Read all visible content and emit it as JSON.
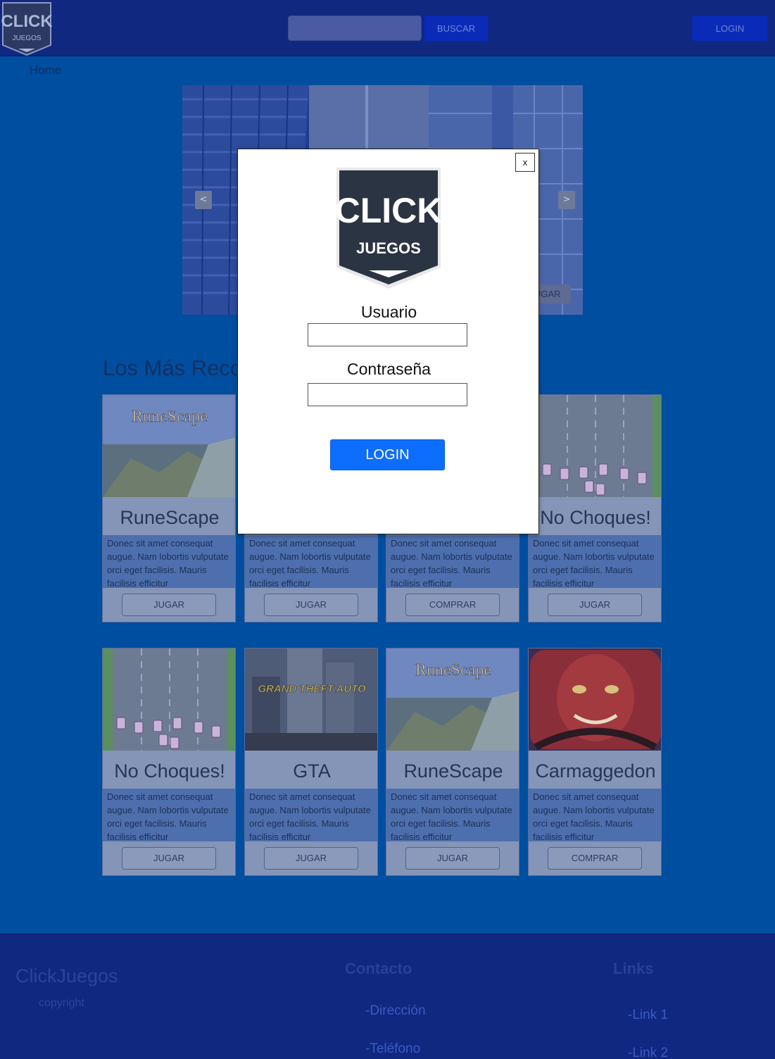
{
  "header": {
    "logo_text_top": "CLICK",
    "logo_text_bottom": "JUEGOS",
    "search_placeholder": "",
    "search_button": "BUSCAR",
    "login_button": "LOGIN"
  },
  "nav": {
    "home": "Home"
  },
  "carousel": {
    "prev": "<",
    "next": ">",
    "cta": "JUGAR"
  },
  "section_title": "Los Más Recomendados",
  "cards_row1": [
    {
      "title": "RuneScape",
      "desc": "Donec sit amet consequat augue. Nam lobortis vulputate orci eget facilisis. Mauris facilisis efficitur",
      "button": "JUGAR"
    },
    {
      "title": "",
      "desc": "Donec sit amet consequat augue. Nam lobortis vulputate orci eget facilisis. Mauris facilisis efficitur",
      "button": "JUGAR"
    },
    {
      "title": "",
      "desc": "Donec sit amet consequat augue. Nam lobortis vulputate orci eget facilisis. Mauris facilisis efficitur",
      "button": "COMPRAR"
    },
    {
      "title": "No Choques!",
      "desc": "Donec sit amet consequat augue. Nam lobortis vulputate orci eget facilisis. Mauris facilisis efficitur",
      "button": "JUGAR"
    }
  ],
  "cards_row2": [
    {
      "title": "No Choques!",
      "desc": "Donec sit amet consequat augue. Nam lobortis vulputate orci eget facilisis. Mauris facilisis efficitur",
      "button": "JUGAR"
    },
    {
      "title": "GTA",
      "desc": "Donec sit amet consequat augue. Nam lobortis vulputate orci eget facilisis. Mauris facilisis efficitur",
      "button": "JUGAR"
    },
    {
      "title": "RuneScape",
      "desc": "Donec sit amet consequat augue. Nam lobortis vulputate orci eget facilisis. Mauris facilisis efficitur",
      "button": "JUGAR"
    },
    {
      "title": "Carmaggedon",
      "desc": "Donec sit amet consequat augue. Nam lobortis vulputate orci eget facilisis. Mauris facilisis efficitur",
      "button": "COMPRAR"
    }
  ],
  "card_art": {
    "runescape_logo": "RuneScape",
    "gta_logo": "GRAND THEFT AUTO"
  },
  "footer": {
    "brand": "ClickJuegos",
    "copyright": "copyright",
    "contact_heading": "Contacto",
    "contact_items": [
      "-Dirección",
      "-Teléfono"
    ],
    "links_heading": "Links",
    "link_items": [
      "-Link 1",
      "-Link 2"
    ]
  },
  "modal": {
    "close": "x",
    "logo_text_top": "CLICK",
    "logo_text_bottom": "JUEGOS",
    "user_label": "Usuario",
    "password_label": "Contraseña",
    "login_button": "LOGIN"
  },
  "colors": {
    "page_bg": "#004ea0",
    "header_bg": "#10287f",
    "modal_button": "#0d6efd"
  }
}
